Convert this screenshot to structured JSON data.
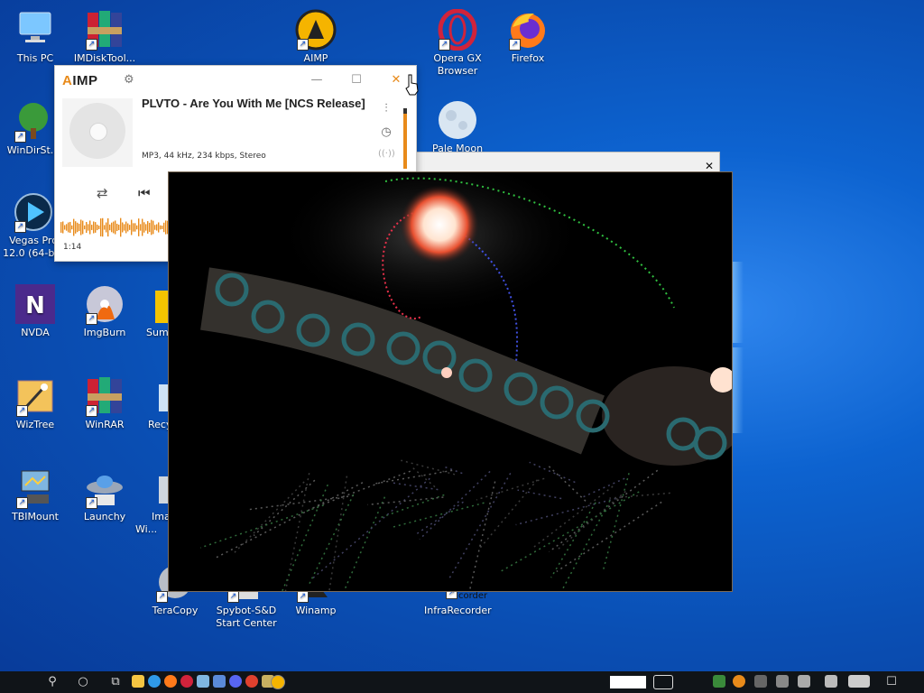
{
  "desktop": {
    "icons": [
      {
        "label": "This PC"
      },
      {
        "label": "IMDiskTool..."
      },
      {
        "label": "AIMP"
      },
      {
        "label": "Opera GX Browser"
      },
      {
        "label": "Firefox"
      },
      {
        "label": "WinDirSt..."
      },
      {
        "label": "Pale Moon"
      },
      {
        "label": "Vegas Pro 12.0 (64-b..."
      },
      {
        "label": "NVDA"
      },
      {
        "label": "ImgBurn"
      },
      {
        "label": "Sum..."
      },
      {
        "label": "WizTree"
      },
      {
        "label": "WinRAR"
      },
      {
        "label": "Recy..."
      },
      {
        "label": "TBIMount"
      },
      {
        "label": "Launchy"
      },
      {
        "label": "Ima... Wi..."
      },
      {
        "label": "TeraCopy"
      },
      {
        "label": "Spybot-S&D Start Center"
      },
      {
        "label": "Winamp"
      },
      {
        "label": "InfraRecorder"
      }
    ],
    "infra_extra": "corder"
  },
  "aimp": {
    "logo_a": "A",
    "logo_rest": "IMP",
    "track_title": "PLVTO - Are You With Me [NCS Release]",
    "meta": "MP3, 44 kHz, 234 kbps, Stereo",
    "time": "1:14",
    "minimize": "—",
    "maximize": "☐",
    "close": "✕",
    "accent": "#e88a1a",
    "volume_fraction": 0.9
  },
  "bgdialog": {
    "close": "✕"
  },
  "taskbar": {
    "search": "⚲",
    "cortana": "○",
    "taskview": "⧉",
    "notification": "☐"
  }
}
